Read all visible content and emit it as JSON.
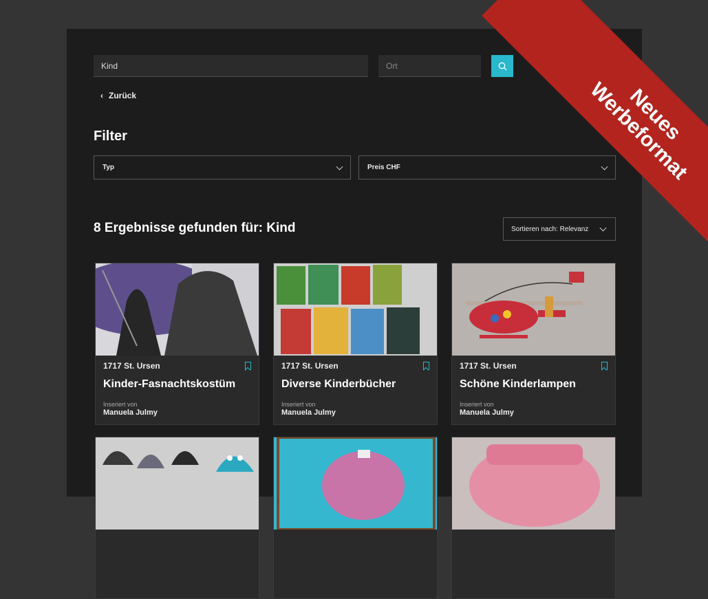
{
  "search": {
    "query_value": "Kind",
    "location_placeholder": "Ort"
  },
  "back_label": "Zurück",
  "filter": {
    "title": "Filter",
    "type_label": "Typ",
    "price_label": "Preis CHF"
  },
  "results": {
    "title": "8 Ergebnisse gefunden für: Kind",
    "sort_label": "Sortieren nach: Relevanz"
  },
  "cards": [
    {
      "location": "1717 St. Ursen",
      "title": "Kinder-Fasnachtskostüm",
      "by_label": "Inseriert von",
      "by_name": "Manuela Julmy"
    },
    {
      "location": "1717 St. Ursen",
      "title": "Diverse Kinderbücher",
      "by_label": "Inseriert von",
      "by_name": "Manuela Julmy"
    },
    {
      "location": "1717 St. Ursen",
      "title": "Schöne Kinderlampen",
      "by_label": "Inseriert von",
      "by_name": "Manuela Julmy"
    },
    {
      "location": "",
      "title": "",
      "by_label": "",
      "by_name": ""
    },
    {
      "location": "",
      "title": "",
      "by_label": "",
      "by_name": ""
    },
    {
      "location": "",
      "title": "",
      "by_label": "",
      "by_name": ""
    }
  ],
  "ribbon": {
    "line1": "Neues",
    "line2": "Werbeformat"
  },
  "colors": {
    "accent": "#29b8cc",
    "ribbon": "#b3241f",
    "page_bg": "#1c1c1c",
    "outer_bg": "#343434"
  },
  "icons": {
    "search": "search-icon",
    "back": "chevron-left-icon",
    "dropdown": "chevron-down-icon",
    "bookmark": "bookmark-icon"
  }
}
